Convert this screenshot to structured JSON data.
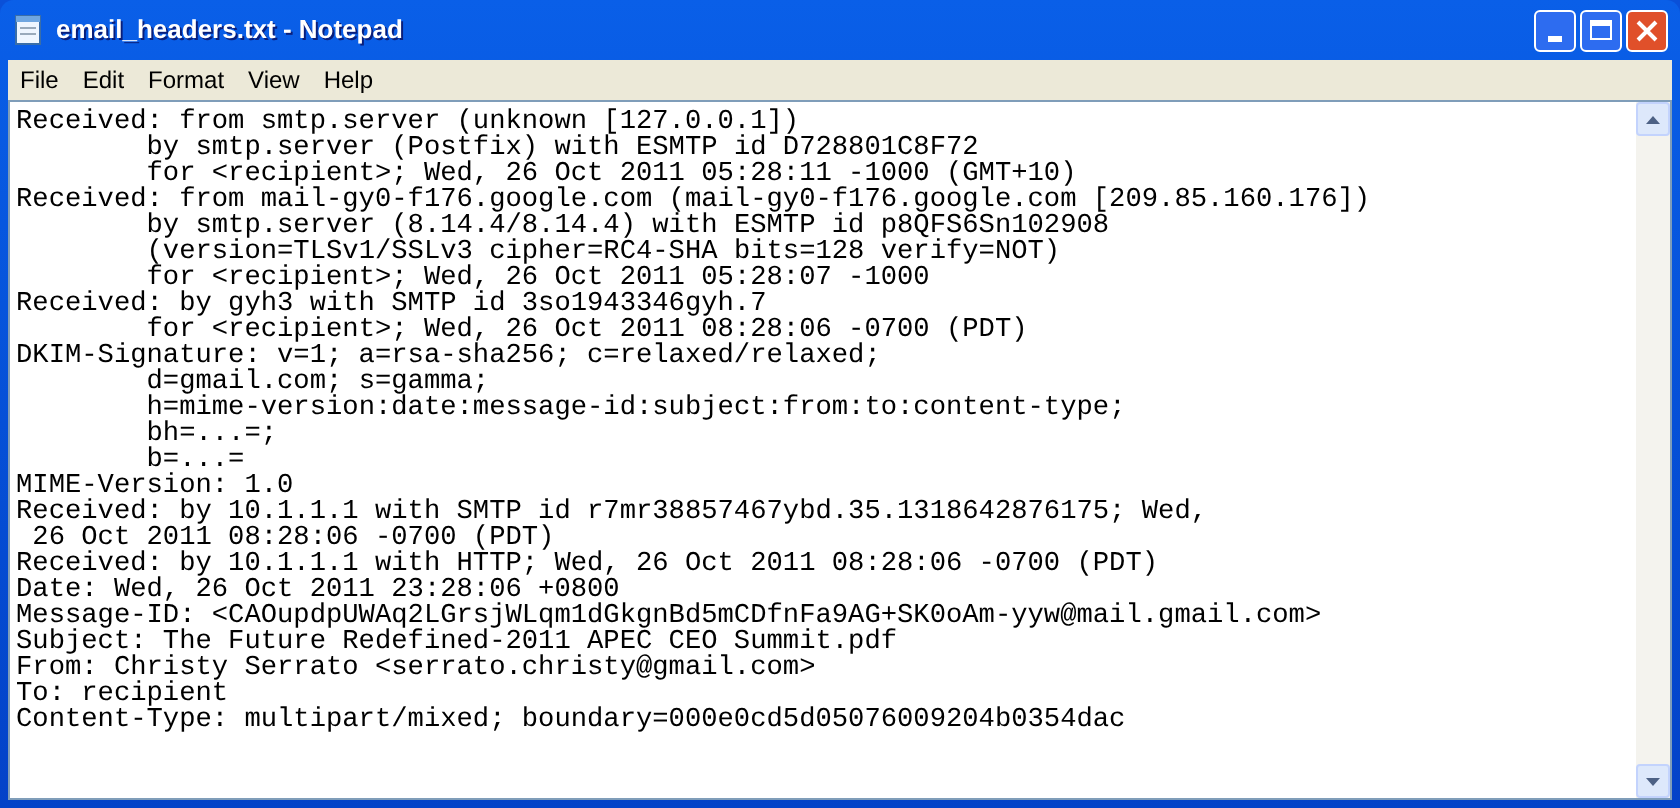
{
  "window": {
    "title": "email_headers.txt - Notepad"
  },
  "menu": [
    "File",
    "Edit",
    "Format",
    "View",
    "Help"
  ],
  "document": {
    "lines": [
      "Received: from smtp.server (unknown [127.0.0.1])",
      "\tby smtp.server (Postfix) with ESMTP id D728801C8F72",
      "\tfor <recipient>; Wed, 26 Oct 2011 05:28:11 -1000 (GMT+10)",
      "Received: from mail-gy0-f176.google.com (mail-gy0-f176.google.com [209.85.160.176])",
      "\tby smtp.server (8.14.4/8.14.4) with ESMTP id p8QFS6Sn102908",
      "\t(version=TLSv1/SSLv3 cipher=RC4-SHA bits=128 verify=NOT)",
      "\tfor <recipient>; Wed, 26 Oct 2011 05:28:07 -1000",
      "Received: by gyh3 with SMTP id 3so1943346gyh.7",
      "\tfor <recipient>; Wed, 26 Oct 2011 08:28:06 -0700 (PDT)",
      "DKIM-Signature: v=1; a=rsa-sha256; c=relaxed/relaxed;",
      "\td=gmail.com; s=gamma;",
      "\th=mime-version:date:message-id:subject:from:to:content-type;",
      "\tbh=...=;",
      "\tb=...=",
      "MIME-Version: 1.0",
      "Received: by 10.1.1.1 with SMTP id r7mr38857467ybd.35.1318642876175; Wed,",
      " 26 Oct 2011 08:28:06 -0700 (PDT)",
      "Received: by 10.1.1.1 with HTTP; Wed, 26 Oct 2011 08:28:06 -0700 (PDT)",
      "Date: Wed, 26 Oct 2011 23:28:06 +0800",
      "Message-ID: <CAOupdpUWAq2LGrsjWLqm1dGkgnBd5mCDfnFa9AG+SK0oAm-yyw@mail.gmail.com>",
      "Subject: The Future Redefined-2011 APEC CEO Summit.pdf",
      "From: Christy Serrato <serrato.christy@gmail.com>",
      "To: recipient",
      "Content-Type: multipart/mixed; boundary=000e0cd5d05076009204b0354dac"
    ]
  }
}
